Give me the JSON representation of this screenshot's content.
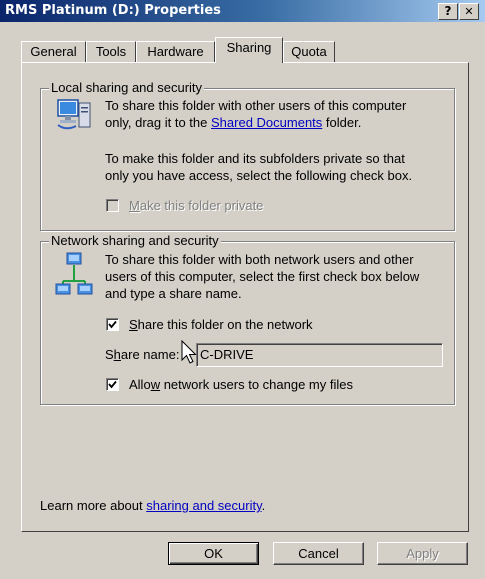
{
  "window": {
    "title": "RMS Platinum (D:) Properties",
    "help_button": "?",
    "close_button": "✕"
  },
  "tabs": [
    {
      "label": "General",
      "active": false
    },
    {
      "label": "Tools",
      "active": false
    },
    {
      "label": "Hardware",
      "active": false
    },
    {
      "label": "Sharing",
      "active": true
    },
    {
      "label": "Quota",
      "active": false
    }
  ],
  "local_sharing": {
    "group_label": "Local sharing and security",
    "icon": "computer-share-icon",
    "line1": "To share this folder with other users of this computer",
    "line2_prefix": "only, drag it to the ",
    "line2_link": "Shared Documents",
    "line2_suffix": " folder.",
    "line3": "To make this folder and its subfolders private so that",
    "line4": "only you have access, select the following check box.",
    "private_checkbox": {
      "label_accel": "M",
      "label_rest": "ake this folder private",
      "checked": false,
      "enabled": false
    }
  },
  "network_sharing": {
    "group_label": "Network sharing and security",
    "icon": "network-share-icon",
    "line1": "To share this folder with both network users and other",
    "line2": "users of this computer, select the first check box below",
    "line3": "and type a share name.",
    "share_checkbox": {
      "label_accel": "S",
      "label_rest": "hare this folder on the network",
      "checked": true
    },
    "share_name": {
      "label_pre": "S",
      "label_accel": "h",
      "label_post": "are name:",
      "value": "C-DRIVE"
    },
    "allow_checkbox": {
      "label_pre": "Allo",
      "label_accel": "w",
      "label_post": " network users to change my files",
      "checked": true
    }
  },
  "footer": {
    "learn_prefix": "Learn more about ",
    "learn_link": "sharing and security",
    "learn_suffix": "."
  },
  "buttons": {
    "ok": "OK",
    "cancel": "Cancel",
    "apply": "Apply"
  }
}
